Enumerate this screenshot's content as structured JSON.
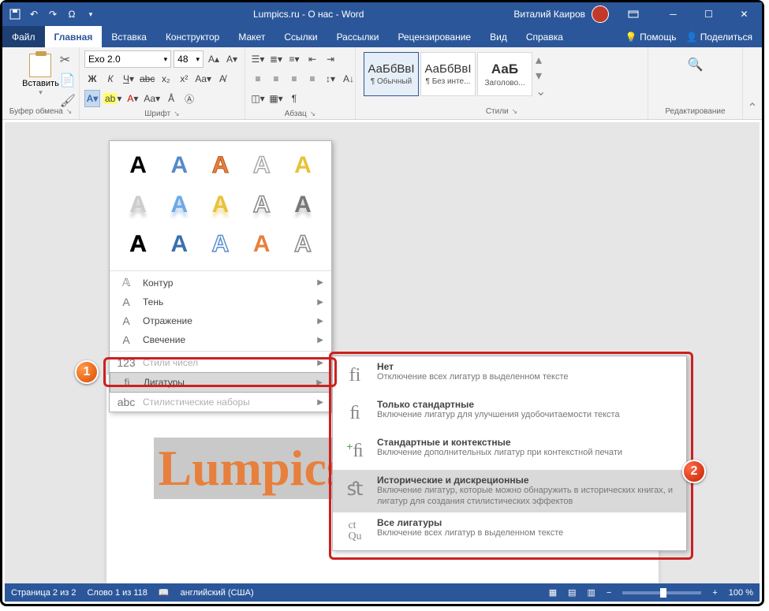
{
  "titlebar": {
    "title": "Lumpics.ru - О нас - Word",
    "user": "Виталий Каиров"
  },
  "tabs": {
    "file": "Файл",
    "home": "Главная",
    "insert": "Вставка",
    "design": "Конструктор",
    "layout": "Макет",
    "references": "Ссылки",
    "mailings": "Рассылки",
    "review": "Рецензирование",
    "view": "Вид",
    "help": "Справка",
    "assist": "Помощь",
    "share": "Поделиться"
  },
  "ribbon": {
    "clipboard": {
      "paste": "Вставить",
      "group": "Буфер обмена"
    },
    "font": {
      "name": "Exo 2.0",
      "size": "48",
      "group": "Шрифт"
    },
    "paragraph": {
      "group": "Абзац"
    },
    "styles": {
      "group": "Стили",
      "s1": {
        "preview": "АаБбВвІ",
        "name": "¶ Обычный"
      },
      "s2": {
        "preview": "АаБбВвІ",
        "name": "¶ Без инте..."
      },
      "s3": {
        "preview": "АаБ",
        "name": "Заголово..."
      }
    },
    "editing": {
      "group": "Редактирование"
    }
  },
  "fx": {
    "outline": "Контур",
    "shadow": "Тень",
    "reflection": "Отражение",
    "glow": "Свечение",
    "numstyles": "Стили чисел",
    "ligatures": "Лигатуры",
    "stylesets": "Стилистические наборы"
  },
  "ligatures": {
    "none": {
      "title": "Нет",
      "desc": "Отключение всех лигатур в выделенном тексте"
    },
    "std": {
      "title": "Только стандартные",
      "desc": "Включение лигатур для улучшения удобочитаемости текста"
    },
    "ctx": {
      "title": "Стандартные и контекстные",
      "desc": "Включение дополнительных лигатур при контекстной печати"
    },
    "hist": {
      "title": "Исторические и дискреционные",
      "desc": "Включение лигатур, которые можно обнаружить в исторических книгах, и лигатур для создания стилистических эффектов"
    },
    "all": {
      "title": "Все лигатуры",
      "desc": "Включение всех лигатур в выделенном тексте"
    }
  },
  "document": {
    "selected_text": "Lumpics"
  },
  "status": {
    "page": "Страница 2 из 2",
    "words": "Слово 1 из 118",
    "lang": "английский (США)",
    "zoom": "100 %"
  }
}
